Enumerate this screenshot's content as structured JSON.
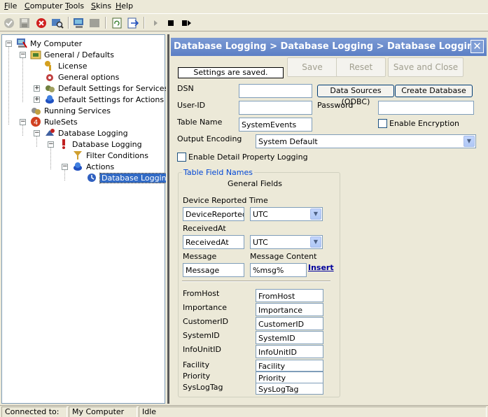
{
  "menu": [
    {
      "label": "File",
      "u": "F",
      "rest": "ile"
    },
    {
      "label": "Computer",
      "u": "C",
      "rest": "omputer"
    },
    {
      "label": "Tools",
      "u": "T",
      "rest": "ools"
    },
    {
      "label": "Skins",
      "u": "S",
      "rest": "kins"
    },
    {
      "label": "Help",
      "u": "H",
      "rest": "elp"
    }
  ],
  "toolbar": {
    "icons": [
      "ok-icon",
      "save-icon",
      "stop-icon",
      "search-icon",
      "computer-icon",
      "disabled-icon",
      "refresh-icon",
      "export-icon",
      "play-icon",
      "stop-square-icon",
      "step-icon"
    ]
  },
  "tree": {
    "nodes": [
      {
        "label": "My Computer",
        "icon": "computer-icon",
        "color": "#4a6fb5"
      },
      {
        "label": "General / Defaults",
        "icon": "folder-icon",
        "color": "#e8c860"
      },
      {
        "label": "License",
        "icon": "key-icon",
        "color": "#d4a020"
      },
      {
        "label": "General options",
        "icon": "gear-icon",
        "color": "#c04040"
      },
      {
        "label": "Default Settings for Services",
        "icon": "services-icon",
        "color": "#708040"
      },
      {
        "label": "Default Settings for Actions",
        "icon": "actions-icon",
        "color": "#2050c0"
      },
      {
        "label": "Running Services",
        "icon": "running-services-icon",
        "color": "#808080"
      },
      {
        "label": "RuleSets",
        "icon": "rulesets-icon",
        "color": "#d04020"
      },
      {
        "label": "Database Logging",
        "icon": "ruleset-icon",
        "color": "#4060a0"
      },
      {
        "label": "Database Logging",
        "icon": "rule-icon",
        "color": "#c02020"
      },
      {
        "label": "Filter Conditions",
        "icon": "filter-icon",
        "color": "#d0a030"
      },
      {
        "label": "Actions",
        "icon": "actions-icon",
        "color": "#2050c0"
      },
      {
        "label": "Database Logging",
        "icon": "db-action-icon",
        "color": "#3060c0"
      }
    ]
  },
  "panel": {
    "title": "Database Logging > Database Logging > Database Logging",
    "status": "Settings are saved.",
    "buttons": {
      "save": "Save",
      "reset": "Reset",
      "save_close": "Save and Close"
    },
    "dsn_label": "DSN",
    "dsn_value": "",
    "data_sources_btn": "Data Sources (ODBC)",
    "create_db_btn": "Create Database",
    "userid_label": "User-ID",
    "userid_value": "",
    "password_label": "Password",
    "password_value": "",
    "table_name_label": "Table Name",
    "table_name_value": "SystemEvents",
    "enable_encryption": "Enable Encryption",
    "output_encoding_label": "Output Encoding",
    "output_encoding_value": "System Default",
    "detail_logging": "Enable Detail Property Logging",
    "group_title": "Table Field Names",
    "general_fields": "General Fields",
    "device_time_label": "Device Reported Time",
    "device_time_value": "DeviceReported",
    "device_tz": "UTC",
    "received_label": "ReceivedAt",
    "received_value": "ReceivedAt",
    "received_tz": "UTC",
    "message_label": "Message",
    "message_value": "Message",
    "message_content_label": "Message Content",
    "message_content_value": "%msg%",
    "insert_link": "Insert",
    "fields": [
      {
        "label": "FromHost",
        "value": "FromHost"
      },
      {
        "label": "Importance",
        "value": "Importance"
      },
      {
        "label": "CustomerID",
        "value": "CustomerID"
      },
      {
        "label": "SystemID",
        "value": "SystemID"
      },
      {
        "label": "InfoUnitID",
        "value": "InfoUnitID"
      },
      {
        "label": "Facility",
        "value": "Facility"
      },
      {
        "label": "Priority",
        "value": "Priority"
      },
      {
        "label": "SysLogTag",
        "value": "SysLogTag"
      }
    ]
  },
  "statusbar": {
    "connected_label": "Connected to:",
    "computer": "My Computer",
    "state": "Idle"
  }
}
